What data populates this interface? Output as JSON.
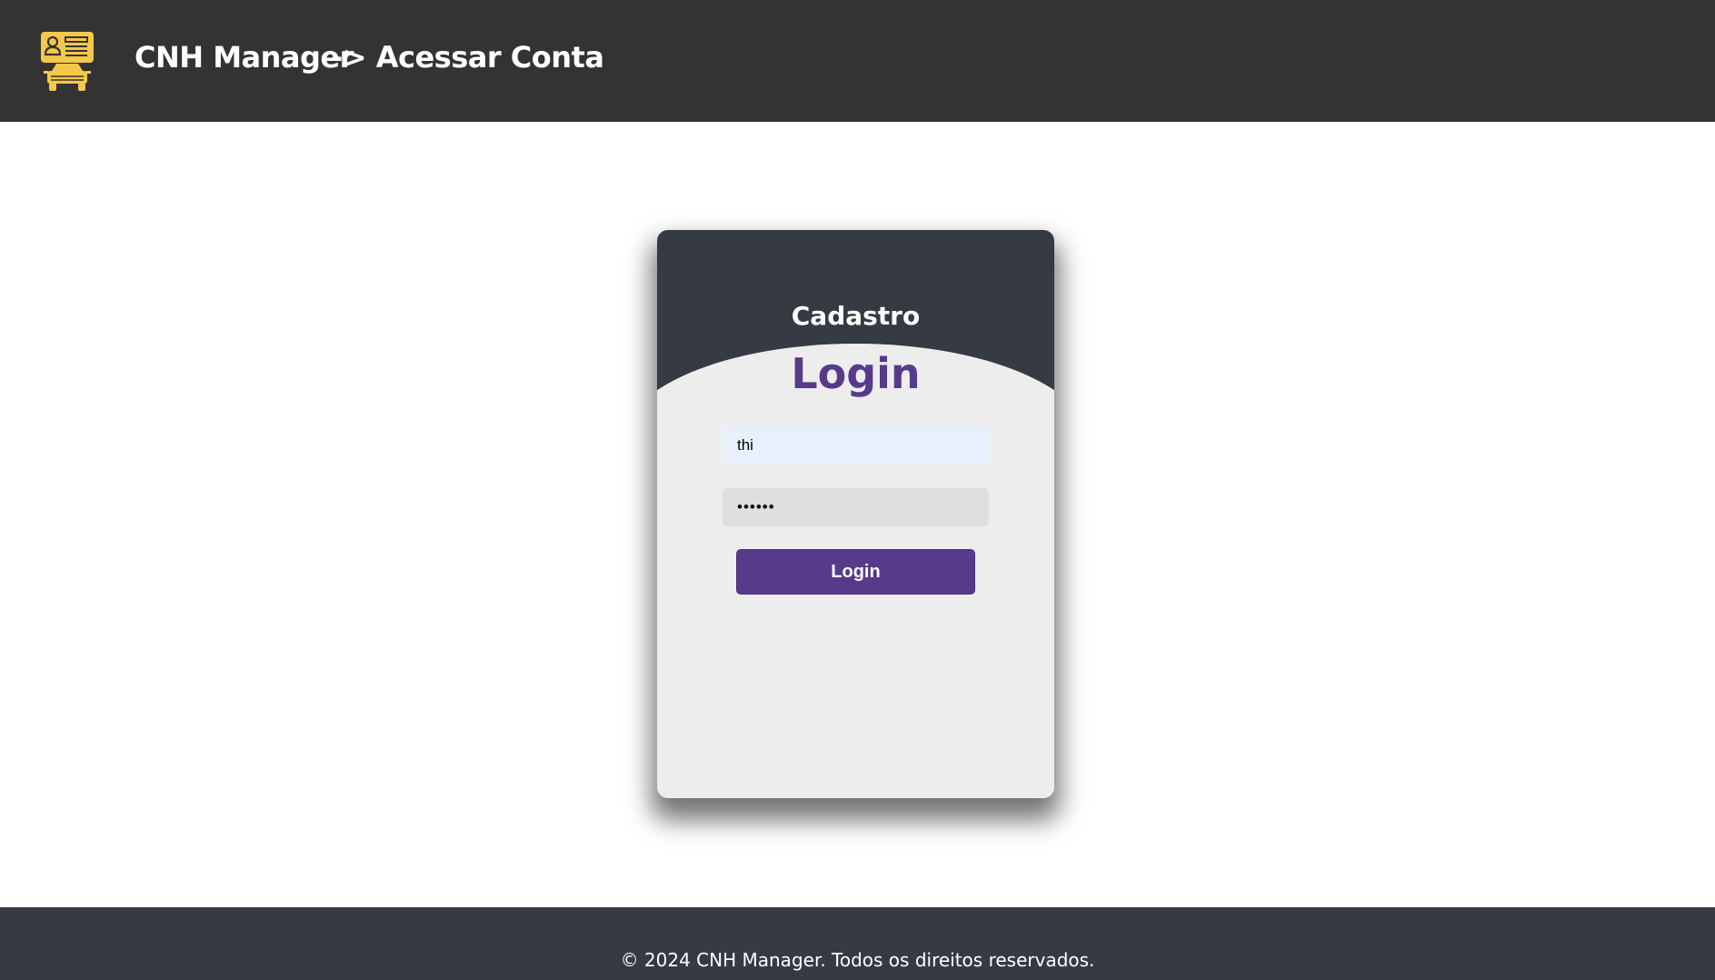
{
  "header": {
    "brand": "CNH Manager",
    "breadcrumb": "-> Acessar Conta",
    "logo_icon": "driver-license-car-icon",
    "logo_color": "#f5c84c",
    "background": "#333333"
  },
  "card": {
    "tab_signup": "Cadastro",
    "tab_login": "Login",
    "username_value": "thi",
    "password_value": "••••••",
    "login_button": "Login",
    "accent_color": "#573b8a"
  },
  "footer": {
    "text": "© 2024 CNH Manager. Todos os direitos reservados."
  }
}
